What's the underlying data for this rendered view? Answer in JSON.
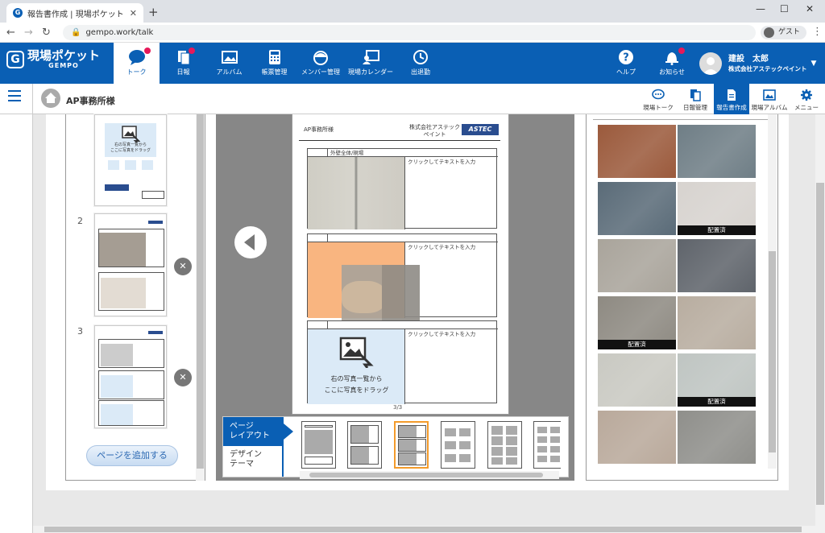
{
  "browser": {
    "tab_title": "報告書作成 | 現場ポケット",
    "url": "gempo.work/talk",
    "profile": "ゲスト"
  },
  "app": {
    "logo_name": "現場ポケット",
    "logo_sub": "GEMPO",
    "nav": [
      {
        "label": "トーク",
        "icon": "chat-icon",
        "active": true,
        "dot": true
      },
      {
        "label": "日報",
        "icon": "report-icon",
        "dot": true
      },
      {
        "label": "アルバム",
        "icon": "album-icon"
      },
      {
        "label": "帳票管理",
        "icon": "calculator-icon"
      },
      {
        "label": "メンバー管理",
        "icon": "helmet-icon"
      },
      {
        "label": "現場カレンダー",
        "icon": "calendar-person-icon"
      },
      {
        "label": "出退勤",
        "icon": "clock-icon"
      },
      {
        "label": "ヘルプ",
        "icon": "help-icon"
      },
      {
        "label": "お知らせ",
        "icon": "bell-icon",
        "dot": true
      }
    ],
    "user_name": "建設　太郎",
    "user_company": "株式会社アステックペイント"
  },
  "subheader": {
    "office": "AP事務所様",
    "nav": [
      {
        "label": "現場トーク",
        "icon": "chat-icon"
      },
      {
        "label": "日報管理",
        "icon": "report-icon"
      },
      {
        "label": "報告書作成",
        "icon": "document-icon",
        "active": true
      },
      {
        "label": "現場アルバム",
        "icon": "album-icon"
      },
      {
        "label": "メニュー",
        "icon": "gear-icon"
      }
    ]
  },
  "thumbnails": {
    "page1_drop_text": "右の写真一覧から\nここに写真をドラッグ",
    "pages": [
      "2",
      "3"
    ],
    "add_page": "ページを追加する"
  },
  "sheet": {
    "header_left": "AP事務所様",
    "header_company": "株式会社アステック\nペイント",
    "brand": "ASTEC",
    "block1_caption": "外壁全体/現場",
    "text_placeholder": "クリックしてテキストを入力",
    "drop_line1": "右の写真一覧から",
    "drop_line2": "ここに写真をドラッグ",
    "pager": "3/3"
  },
  "layout_panel": {
    "tab_page": "ページ\nレイアウト",
    "tab_design": "デザイン\nテーマ"
  },
  "photos": {
    "badge": "配置済",
    "tiles": [
      {
        "color": "#9b5a3c",
        "badge": false
      },
      {
        "color": "#6f7e86",
        "badge": false
      },
      {
        "color": "#5a6b78",
        "badge": false
      },
      {
        "color": "#d7d3cf",
        "badge": true
      },
      {
        "color": "#a9a49b",
        "badge": false
      },
      {
        "color": "#5f646b",
        "badge": false
      },
      {
        "color": "#8e8a82",
        "badge": true
      },
      {
        "color": "#b8ada0",
        "badge": false
      },
      {
        "color": "#c9c9c2",
        "badge": false
      },
      {
        "color": "#bfc5c2",
        "badge": true
      },
      {
        "color": "#b9a99b",
        "badge": false
      },
      {
        "color": "#8f8f8b",
        "badge": false
      }
    ]
  }
}
